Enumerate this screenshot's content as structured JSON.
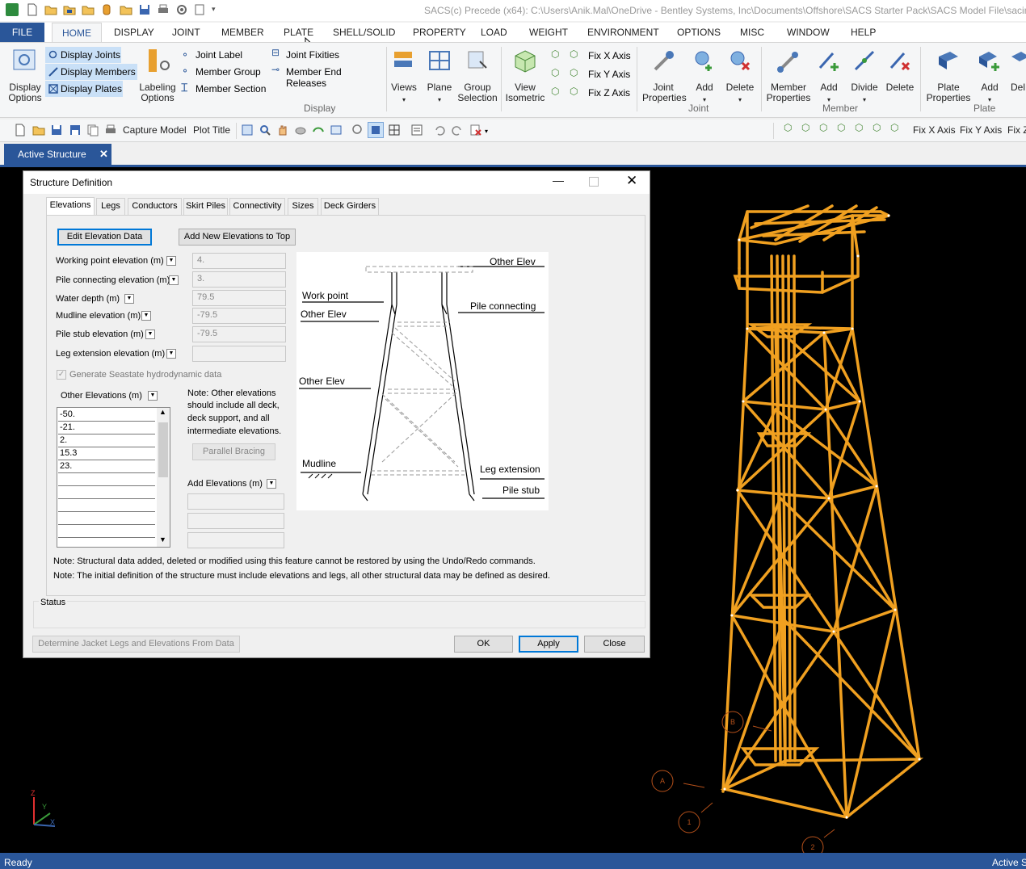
{
  "window": {
    "title": "SACS(c) Precede (x64):  C:\\Users\\Anik.Mal\\OneDrive - Bentley Systems, Inc\\Documents\\Offshore\\SACS Starter Pack\\SACS Model File\\sacinp.r"
  },
  "menu": {
    "file": "FILE",
    "home": "HOME",
    "display": "DISPLAY",
    "joint": "JOINT",
    "member": "MEMBER",
    "plate": "PLATE",
    "shell_solid": "SHELL/SOLID",
    "property": "PROPERTY",
    "load": "LOAD",
    "weight": "WEIGHT",
    "environment": "ENVIRONMENT",
    "options": "OPTIONS",
    "misc": "MISC",
    "window": "WINDOW",
    "help": "HELP"
  },
  "ribbon": {
    "display_options_1": "Display",
    "display_options_2": "Options",
    "display_joints": "Display Joints",
    "display_members": "Display Members",
    "display_plates": "Display Plates",
    "labeling_1": "Labeling",
    "labeling_2": "Options",
    "joint_label": "Joint Label",
    "member_group": "Member Group",
    "member_section": "Member Section",
    "joint_fixities": "Joint Fixities",
    "member_end_releases": "Member End Releases",
    "display_group": "Display",
    "views": "Views",
    "plane": "Plane",
    "group_selection_1": "Group",
    "group_selection_2": "Selection",
    "view_iso_1": "View",
    "view_iso_2": "Isometric",
    "fix_x": "Fix X Axis",
    "fix_y": "Fix Y Axis",
    "fix_z": "Fix Z Axis",
    "joint_props_1": "Joint",
    "joint_props_2": "Properties",
    "add": "Add",
    "delete": "Delete",
    "joint_group": "Joint",
    "member_props_1": "Member",
    "member_props_2": "Properties",
    "divide": "Divide",
    "member_group_title": "Member",
    "plate_props_1": "Plate",
    "plate_props_2": "Properties",
    "plate_group": "Plate",
    "del_partial": "Del"
  },
  "toolbar": {
    "capture_model": "Capture Model",
    "plot_title": "Plot Title",
    "fix_x": "Fix X Axis",
    "fix_y": "Fix Y Axis",
    "fix_z": "Fix Z"
  },
  "doc_tab": {
    "label": "Active Structure",
    "close": "✕"
  },
  "dialog": {
    "title": "Structure Definition",
    "tabs": [
      "Elevations",
      "Legs",
      "Conductors",
      "Skirt Piles",
      "Connectivity",
      "Sizes",
      "Deck Girders"
    ],
    "edit_elevation_data": "Edit Elevation Data",
    "add_new_elevations": "Add New Elevations to Top",
    "fields": {
      "working_point": {
        "label": "Working point elevation  (m)",
        "value": "4."
      },
      "pile_connecting": {
        "label": "Pile connecting elevation  (m)",
        "value": "3."
      },
      "water_depth": {
        "label": "Water depth  (m)",
        "value": "79.5"
      },
      "mudline": {
        "label": "Mudline elevation  (m)",
        "value": "-79.5"
      },
      "pile_stub": {
        "label": "Pile stub elevation  (m)",
        "value": "-79.5"
      },
      "leg_extension": {
        "label": "Leg extension elevation  (m)",
        "value": ""
      }
    },
    "generate_seastate": "Generate Seastate hydrodynamic data",
    "other_elevations_label": "Other Elevations   (m)",
    "other_elevations": [
      "-50.",
      "-21.",
      "2.",
      "15.3",
      "23."
    ],
    "note_lines": [
      "Note:  Other elevations",
      "should include all deck,",
      "deck support, and all",
      "intermediate elevations."
    ],
    "parallel_bracing": "Parallel Bracing",
    "add_elevations_label": "Add Elevations   (m)",
    "diagram": {
      "other_elev_top": "Other Elev",
      "work_point": "Work point",
      "other_elev_left1": "Other Elev",
      "pile_connecting": "Pile connecting",
      "other_elev_left2": "Other Elev",
      "mudline": "Mudline",
      "leg_extension": "Leg extension",
      "pile_stub": "Pile stub"
    },
    "note1": "Note: Structural data added, deleted or modified using this feature cannot be restored by using the Undo/Redo commands.",
    "note2": "Note: The initial definition of the structure must include elevations and legs, all other structural data may be defined as desired.",
    "status_label": "Status",
    "determine_button": "Determine Jacket Legs and Elevations From Data",
    "ok": "OK",
    "apply": "Apply",
    "close": "Close"
  },
  "viewport": {
    "grid_labels": [
      "A",
      "B",
      "1",
      "2"
    ],
    "axis_z": "Z",
    "axis_y": "Y",
    "axis_x": "X"
  },
  "status": {
    "ready": "Ready",
    "right": "Active S"
  },
  "colors": {
    "accent": "#2a5699",
    "structure": "#f0a020",
    "highlight": "#c9e0f7"
  }
}
